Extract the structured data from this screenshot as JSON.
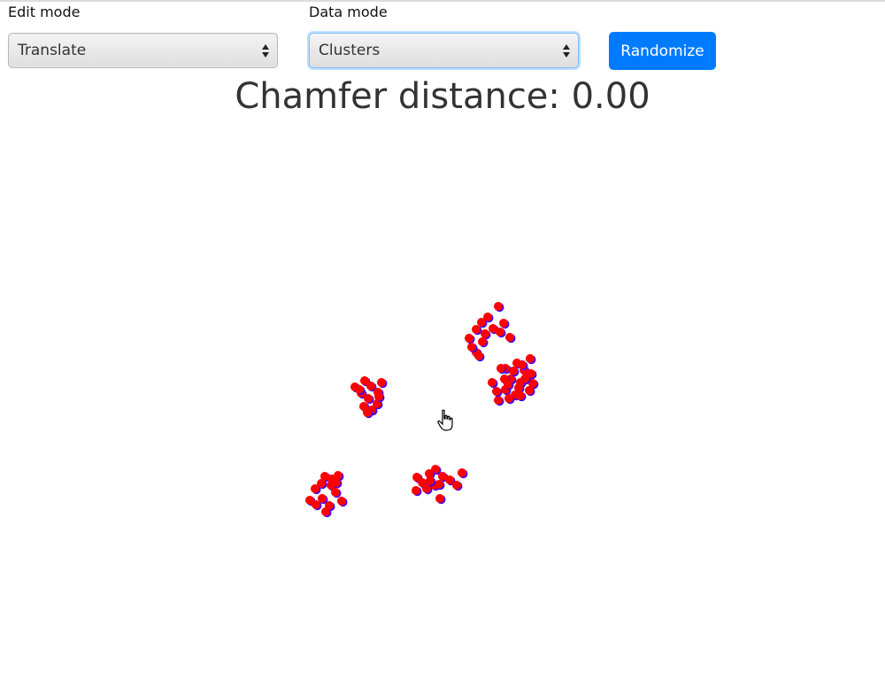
{
  "controls": {
    "edit_mode_label": "Edit mode",
    "edit_mode_value": "Translate",
    "data_mode_label": "Data mode",
    "data_mode_value": "Clusters",
    "randomize_label": "Randomize"
  },
  "header": {
    "title": "Chamfer distance: 0.00"
  },
  "colors": {
    "accent": "#007bff",
    "point_fill": "#ff0000",
    "point_outline": "#3b00ff",
    "background": "#ffffff"
  },
  "icons": {
    "cursor": "hand-pointer-icon",
    "select_arrows": "up-down-arrows-icon"
  },
  "chart_data": {
    "type": "scatter",
    "title": "",
    "xlabel": "",
    "ylabel": "",
    "series": [
      {
        "points": [
          [
            563,
            346
          ],
          [
            551,
            358
          ],
          [
            569,
            365
          ],
          [
            544,
            364
          ],
          [
            557,
            371
          ],
          [
            538,
            372
          ],
          [
            548,
            377
          ],
          [
            530,
            382
          ],
          [
            565,
            375
          ],
          [
            576,
            381
          ],
          [
            545,
            386
          ],
          [
            538,
            398
          ],
          [
            541,
            402
          ],
          [
            533,
            392
          ],
          [
            571,
            416
          ],
          [
            584,
            410
          ],
          [
            592,
            418
          ],
          [
            599,
            405
          ],
          [
            595,
            426
          ],
          [
            602,
            433
          ],
          [
            588,
            432
          ],
          [
            577,
            428
          ],
          [
            566,
            416
          ],
          [
            556,
            432
          ],
          [
            571,
            440
          ],
          [
            582,
            446
          ],
          [
            598,
            441
          ],
          [
            563,
            452
          ],
          [
            575,
            450
          ],
          [
            586,
            438
          ],
          [
            593,
            428
          ],
          [
            580,
            419
          ],
          [
            570,
            428
          ],
          [
            561,
            442
          ],
          [
            600,
            422
          ],
          [
            588,
            447
          ],
          [
            574,
            434
          ],
          [
            590,
            412
          ],
          [
            412,
            430
          ],
          [
            401,
            437
          ],
          [
            419,
            436
          ],
          [
            427,
            443
          ],
          [
            431,
            432
          ],
          [
            408,
            444
          ],
          [
            416,
            450
          ],
          [
            426,
            456
          ],
          [
            411,
            459
          ],
          [
            420,
            463
          ],
          [
            415,
            466
          ],
          [
            428,
            448
          ],
          [
            406,
            440
          ],
          [
            492,
            530
          ],
          [
            485,
            535
          ],
          [
            471,
            539
          ],
          [
            500,
            538
          ],
          [
            508,
            542
          ],
          [
            522,
            534
          ],
          [
            477,
            545
          ],
          [
            491,
            548
          ],
          [
            482,
            552
          ],
          [
            496,
            547
          ],
          [
            470,
            554
          ],
          [
            516,
            548
          ],
          [
            497,
            563
          ],
          [
            486,
            543
          ],
          [
            367,
            538
          ],
          [
            375,
            541
          ],
          [
            382,
            537
          ],
          [
            363,
            546
          ],
          [
            374,
            548
          ],
          [
            356,
            552
          ],
          [
            379,
            556
          ],
          [
            350,
            565
          ],
          [
            364,
            563
          ],
          [
            372,
            571
          ],
          [
            386,
            566
          ],
          [
            357,
            570
          ],
          [
            368,
            578
          ],
          [
            380,
            545
          ]
        ]
      }
    ]
  }
}
